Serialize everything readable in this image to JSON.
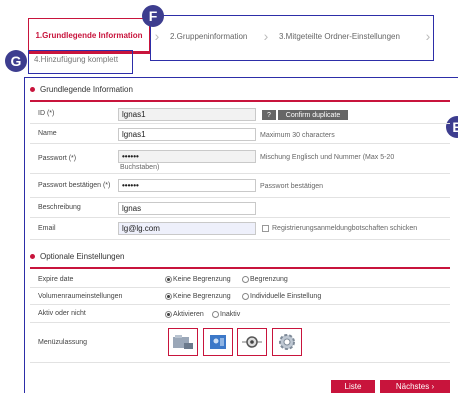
{
  "wizard": {
    "steps": [
      {
        "label": "1.Grundlegende Information"
      },
      {
        "label": "2.Gruppeninformation"
      },
      {
        "label": "3.Mitgeteilte Ordner-Einstellungen"
      },
      {
        "label": "4.Hinzufügung komplett"
      }
    ]
  },
  "markers": {
    "f": "F",
    "g": "G",
    "e": "E"
  },
  "basic": {
    "title": "Grundlegende Information",
    "id": {
      "label": "ID (*)",
      "value": "lgnas1",
      "help_btn": "?",
      "confirm_btn": "Confirm duplicate"
    },
    "name": {
      "label": "Name",
      "value": "lgnas1",
      "hint": "Maximum 30 characters"
    },
    "password": {
      "label": "Passwort (*)",
      "value": "••••••",
      "hint": "Mischung Englisch und Nummer (Max 5-20",
      "hint2": "Buchstaben)"
    },
    "confirm": {
      "label": "Passwort bestätigen (*)",
      "value": "••••••",
      "hint": "Passwort bestätigen"
    },
    "description": {
      "label": "Beschreibung",
      "value": "lgnas"
    },
    "email": {
      "label": "Email",
      "value": "lg@lg.com",
      "checkbox_label": "Registrierungsanmeldungbotschaften schicken"
    }
  },
  "optional": {
    "title": "Optionale Einstellungen",
    "expire": {
      "label": "Expire date",
      "opt1": "Keine Begrenzung",
      "opt2": "Begrenzung"
    },
    "volume": {
      "label": "Volumenraumeinstellungen",
      "opt1": "Keine Begrenzung",
      "opt2": "Individuelle Einstellung"
    },
    "active": {
      "label": "Aktiv oder nicht",
      "opt1": "Aktivieren",
      "opt2": "Inaktiv"
    },
    "menu": {
      "label": "Menüzulassung"
    }
  },
  "footer": {
    "list": "Liste",
    "next": "Nächstes ›"
  },
  "colors": {
    "accent": "#c8143c",
    "annotation": "#2d2ea8"
  }
}
